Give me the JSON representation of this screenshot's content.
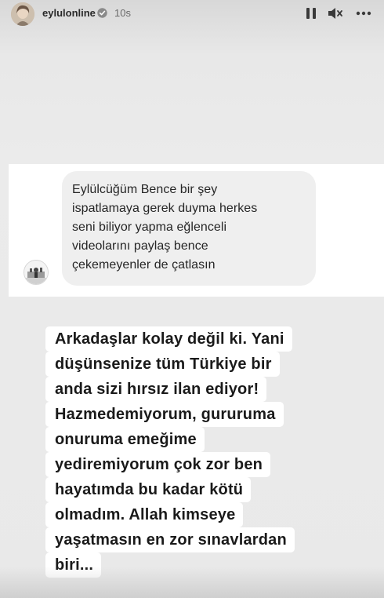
{
  "header": {
    "username": "eylulonline",
    "time_ago": "10s",
    "icons": {
      "verified": "verified-badge-icon",
      "pause": "pause-icon",
      "mute": "mute-icon",
      "more": "more-options-icon"
    }
  },
  "dm_message": {
    "lines": [
      "Eylülcüğüm Bence bir şey",
      "ispatlamaya gerek duyma herkes",
      "seni biliyor yapma eğlenceli",
      "videolarını paylaş bence",
      "çekemeyenler de çatlasın"
    ]
  },
  "caption": {
    "lines": [
      "Arkadaşlar kolay değil ki. Yani",
      "düşünsenize tüm Türkiye bir",
      "anda sizi hırsız ilan ediyor!",
      "Hazmedemiyorum, gururuma",
      "onuruma emeğime",
      "yediremiyorum çok zor ben",
      "hayatımda bu kadar kötü",
      "olmadım. Allah kimseye",
      "yaşatmasın en zor sınavlardan",
      "biri..."
    ]
  },
  "colors": {
    "background": "#e9e9e9",
    "dm_bubble": "#efefef",
    "caption_highlight": "#ffffff",
    "text_dark": "#262626"
  }
}
